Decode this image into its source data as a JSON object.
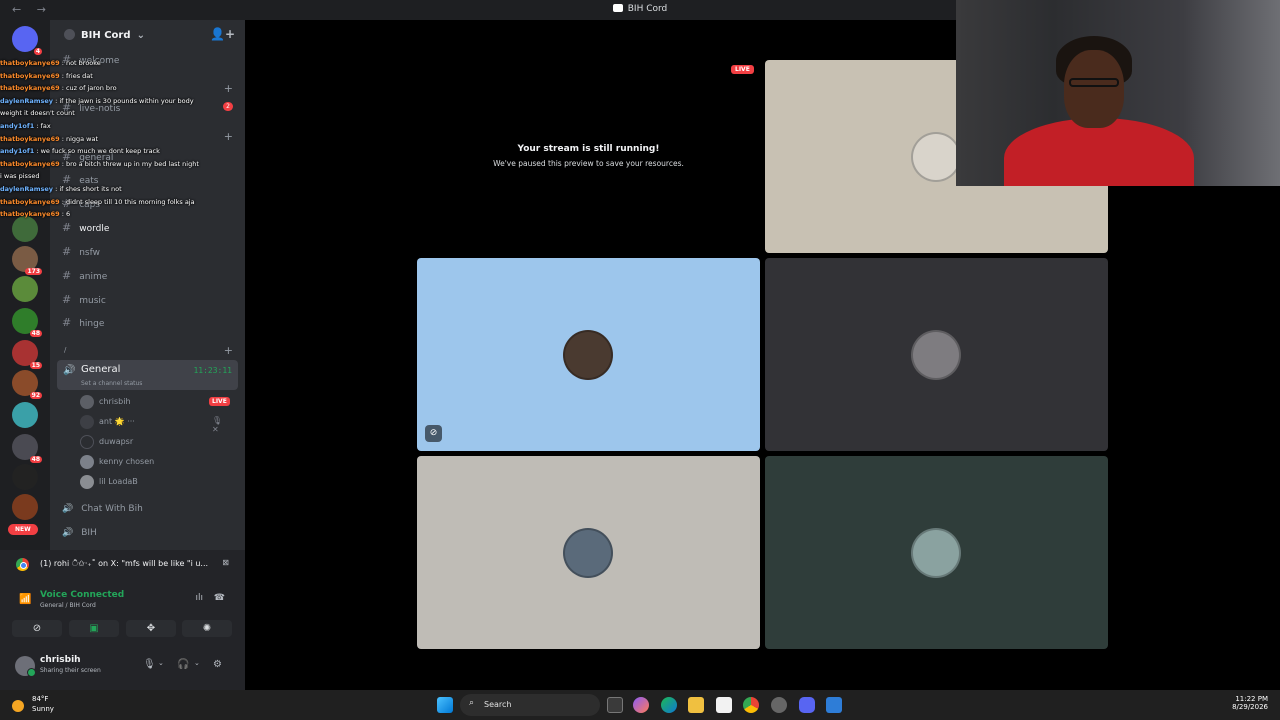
{
  "window": {
    "title": "BIH Cord",
    "nav": "← →"
  },
  "server": {
    "name": "BIH Cord"
  },
  "rail": {
    "new_label": "NEW",
    "badges": [
      "4",
      "173",
      "48",
      "15",
      "92",
      "48"
    ]
  },
  "channels": [
    {
      "name": "welcome"
    },
    {
      "name": "live-notis",
      "unread": "2"
    },
    {
      "name": "general"
    },
    {
      "name": "eats"
    },
    {
      "name": "caps"
    },
    {
      "name": "wordle"
    },
    {
      "name": "nsfw"
    },
    {
      "name": "anime"
    },
    {
      "name": "music"
    },
    {
      "name": "hinge"
    }
  ],
  "category": {
    "label": "/"
  },
  "voice_channel": {
    "name": "General",
    "timer": "11:23:11",
    "status_placeholder": "Set a channel status",
    "users": [
      {
        "name": "chrisbih",
        "live": "LIVE"
      },
      {
        "name": "ant",
        "extra": "🌟 ···"
      },
      {
        "name": "duwapsr"
      },
      {
        "name": "kenny chosen"
      },
      {
        "name": "lil LoadaB"
      }
    ]
  },
  "other_voice": [
    {
      "name": "Chat With Bih"
    },
    {
      "name": "BIH"
    }
  ],
  "chat_overlay": [
    {
      "user": "thatboykanye69",
      "msg": "not brooke"
    },
    {
      "user": "thatboykanye69",
      "msg": "fries dat"
    },
    {
      "user": "thatboykanye69",
      "msg": "cuz of jaron bro"
    },
    {
      "user": "daylenRamsey",
      "msg": "if the jawn is 30 pounds within your body"
    },
    {
      "user": "",
      "msg": "weight it doesn't count"
    },
    {
      "user": "andy1of1",
      "msg": "fax"
    },
    {
      "user": "thatboykanye69",
      "msg": "nigga wat"
    },
    {
      "user": "andy1of1",
      "msg": "we fuck so much we dont keep track"
    },
    {
      "user": "thatboykanye69",
      "msg": "bro a bitch threw up in my bed last night"
    },
    {
      "user": "",
      "msg": "i was pissed"
    },
    {
      "user": "daylenRamsey",
      "msg": "if shes short its not"
    },
    {
      "user": "thatboykanye69",
      "msg": "didnt sleep till 10 this morning folks aja"
    },
    {
      "user": "thatboykanye69",
      "msg": "6"
    }
  ],
  "activity": {
    "text": "(1) rohi ੈ✩‧₊˚ on X: \"mfs will be like \"i u..."
  },
  "voice_status": {
    "title": "Voice Connected",
    "sub": "General / BIH Cord"
  },
  "user_panel": {
    "name": "chrisbih",
    "status": "Sharing their screen"
  },
  "stage": {
    "paused_title": "Your stream is still running!",
    "paused_sub": "We've paused this preview to save your resources.",
    "live_label": "LIVE"
  },
  "taskbar": {
    "weather_temp": "84°F",
    "weather_cond": "Sunny",
    "search_label": "Search",
    "time": "11:22 PM",
    "date": "8/29/2026"
  },
  "colors": {
    "accent_green": "#23a559",
    "live_red": "#f23f43",
    "tile_blue": "#9dc6ec",
    "tile_beige": "#c8c1b3",
    "tile_dark": "#323236",
    "tile_teal": "#2f3d3a"
  }
}
